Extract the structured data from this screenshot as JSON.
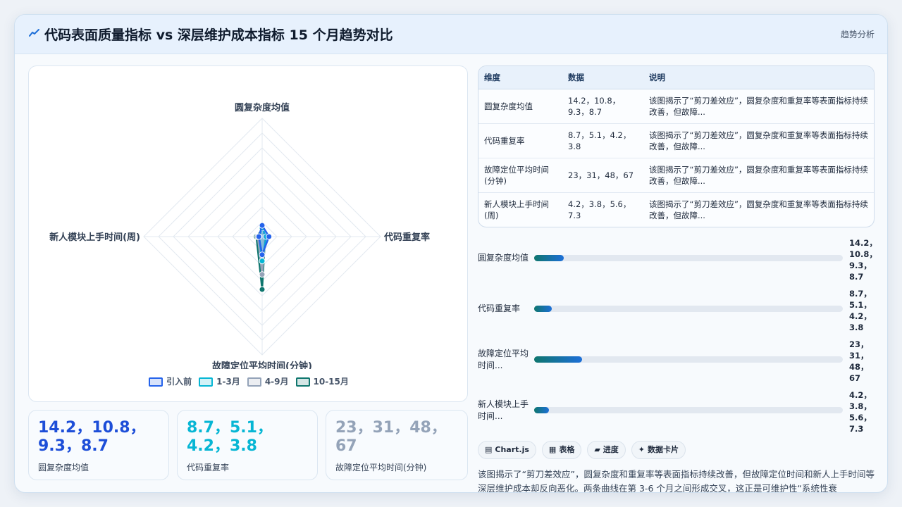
{
  "header": {
    "title": "代码表面质量指标 vs 深层维护成本指标 15 个月趋势对比",
    "tag": "趋势分析"
  },
  "colors": {
    "accent_blue": "#2563eb",
    "accent_cyan": "#06b6d4",
    "accent_slate": "#94a3b8",
    "accent_teal": "#0f766e"
  },
  "chart_data": {
    "type": "radar",
    "axes": [
      "圆复杂度均值",
      "代码重复率",
      "故障定位平均时间(分钟)",
      "新人模块上手时间(周)"
    ],
    "categories": [
      "引入前",
      "1-3月",
      "4-9月",
      "10-15月"
    ],
    "series": [
      {
        "name": "引入前",
        "values": [
          14.2,
          8.7,
          23,
          4.2
        ],
        "color": "#2563eb"
      },
      {
        "name": "1-3月",
        "values": [
          10.8,
          5.1,
          31,
          3.8
        ],
        "color": "#06b6d4"
      },
      {
        "name": "4-9月",
        "values": [
          9.3,
          4.2,
          48,
          5.6
        ],
        "color": "#94a3b8"
      },
      {
        "name": "10-15月",
        "values": [
          8.7,
          3.8,
          67,
          7.3
        ],
        "color": "#0f766e"
      }
    ],
    "r_range": [
      0,
      150
    ],
    "grid": true,
    "legend_position": "bottom"
  },
  "table": {
    "headers": [
      "维度",
      "数据",
      "说明"
    ],
    "rows": [
      {
        "dim": "圆复杂度均值",
        "data": "14.2，10.8，9.3，8.7",
        "note": "该图揭示了“剪刀差效应”，圆复杂度和重复率等表面指标持续改善，但故障..."
      },
      {
        "dim": "代码重复率",
        "data": "8.7，5.1，4.2，3.8",
        "note": "该图揭示了“剪刀差效应”，圆复杂度和重复率等表面指标持续改善，但故障..."
      },
      {
        "dim": "故障定位平均时间(分钟)",
        "data": "23，31，48，67",
        "note": "该图揭示了“剪刀差效应”，圆复杂度和重复率等表面指标持续改善，但故障..."
      },
      {
        "dim": "新人模块上手时间(周)",
        "data": "4.2，3.8，5.6，7.3",
        "note": "该图揭示了“剪刀差效应”，圆复杂度和重复率等表面指标持续改善，但故障..."
      }
    ]
  },
  "progress": [
    {
      "label": "圆复杂度均值",
      "values": "14.2，10.8，9.3，8.7",
      "fraction": 0.095
    },
    {
      "label": "代码重复率",
      "values": "8.7，5.1，4.2，3.8",
      "fraction": 0.058
    },
    {
      "label": "故障定位平均时间...",
      "values": "23，31，48，67",
      "fraction": 0.155
    },
    {
      "label": "新人模块上手时间...",
      "values": "4.2，3.8，5.6，7.3",
      "fraction": 0.048
    }
  ],
  "stats": [
    {
      "value": "14.2，10.8，9.3，8.7",
      "label": "圆复杂度均值",
      "color": "#1d4ed8"
    },
    {
      "value": "8.7，5.1，4.2，3.8",
      "label": "代码重复率",
      "color": "#06b6d4"
    },
    {
      "value": "23，31，48，67",
      "label": "故障定位平均时间(分钟)",
      "color": "#94a3b8"
    }
  ],
  "chips": [
    {
      "icon": "▤",
      "icon_name": "chart-icon",
      "label": "Chart.js"
    },
    {
      "icon": "▦",
      "icon_name": "table-icon",
      "label": "表格"
    },
    {
      "icon": "▰",
      "icon_name": "progress-icon",
      "label": "进度"
    },
    {
      "icon": "✦",
      "icon_name": "sparkle-icon",
      "label": "数据卡片"
    }
  ],
  "description": "该图揭示了“剪刀差效应”，圆复杂度和重复率等表面指标持续改善，但故障定位时间和新人上手时间等深层维护成本却反向恶化。两条曲线在第 3-6 个月之间形成交叉，这正是可维护性“系统性衰"
}
